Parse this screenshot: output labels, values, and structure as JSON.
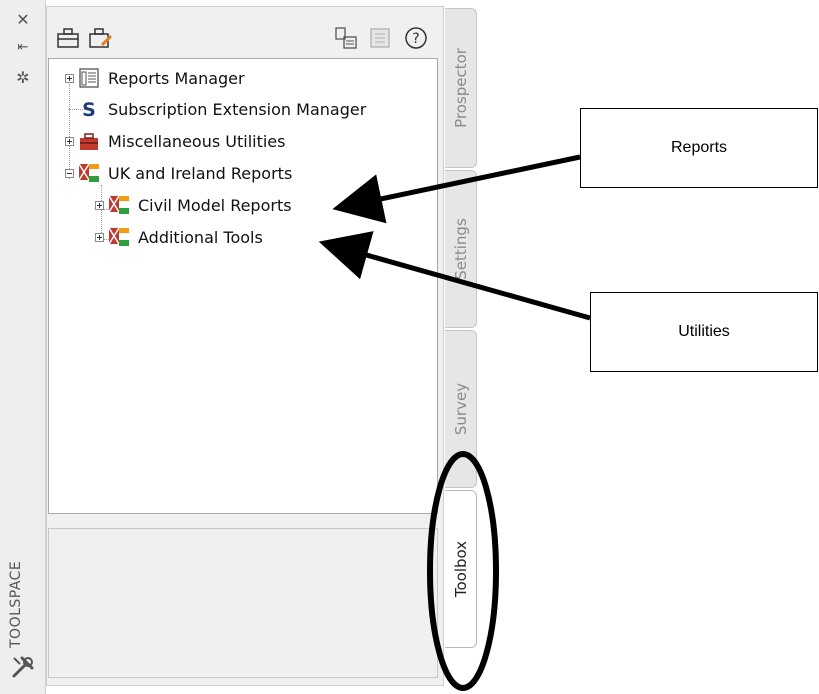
{
  "window": {
    "title": "TOOLSPACE"
  },
  "tree": {
    "items": [
      {
        "label": "Reports Manager",
        "icon": "reports-manager-icon"
      },
      {
        "label": "Subscription Extension Manager",
        "icon": "subscription-s-icon"
      },
      {
        "label": "Miscellaneous Utilities",
        "icon": "toolbox-icon"
      },
      {
        "label": "UK and Ireland Reports",
        "icon": "uk-flag-icon"
      },
      {
        "label": "Civil Model Reports",
        "icon": "uk-flag-icon"
      },
      {
        "label": "Additional Tools",
        "icon": "uk-flag-icon"
      }
    ]
  },
  "tabs": [
    "Prospector",
    "Settings",
    "Survey",
    "Toolbox"
  ],
  "callouts": {
    "reports": "Reports",
    "utilities": "Utilities"
  },
  "colors": {
    "accent_red": "#c0392b",
    "accent_green": "#2e9e3e",
    "accent_orange": "#f39c12",
    "navy": "#1f3a7a"
  }
}
